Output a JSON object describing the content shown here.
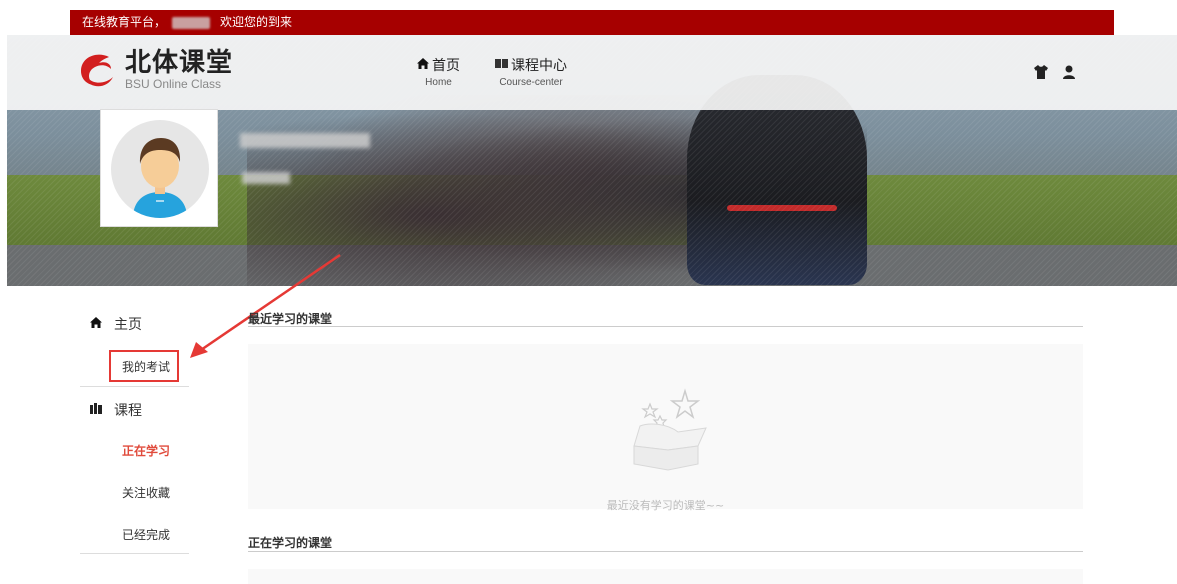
{
  "topbar": {
    "greeting": "在线教育平台，",
    "welcome": "欢迎您的到来"
  },
  "logo": {
    "title": "北体课堂",
    "subtitle": "BSU Online Class"
  },
  "nav": [
    {
      "label": "首页",
      "sub": "Home",
      "icon": "home-icon"
    },
    {
      "label": "课程中心",
      "sub": "Course-center",
      "icon": "book-icon"
    }
  ],
  "header_icons": [
    "shirt-icon",
    "user-icon"
  ],
  "sidebar": {
    "home_label": "主页",
    "exam_label": "我的考试",
    "course_label": "课程",
    "studying_label": "正在学习",
    "favorites_label": "关注收藏",
    "completed_label": "已经完成"
  },
  "main": {
    "recent_title": "最近学习的课堂",
    "recent_empty": "最近没有学习的课堂~~",
    "studying_title": "正在学习的课堂"
  },
  "colors": {
    "brand_red": "#a60000",
    "active": "#e04b3c",
    "annotation": "#e53935"
  }
}
